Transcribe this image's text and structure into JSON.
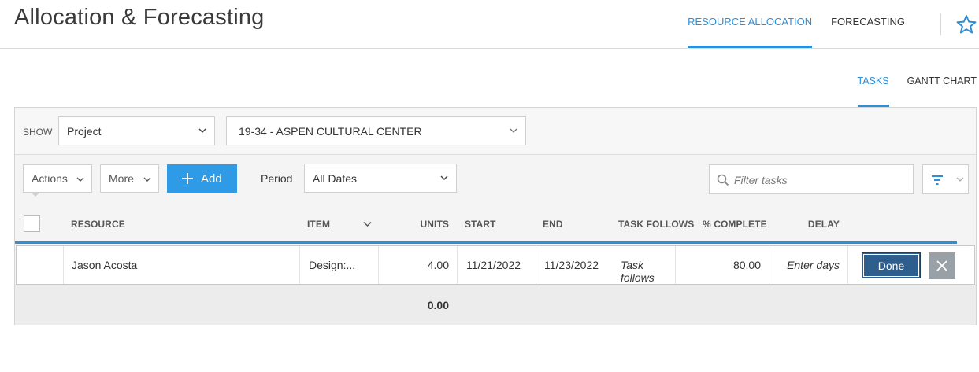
{
  "header": {
    "title": "Allocation & Forecasting",
    "tabs": [
      {
        "label": "RESOURCE ALLOCATION",
        "active": true
      },
      {
        "label": "FORECASTING",
        "active": false
      }
    ],
    "favorite_icon": "star-icon"
  },
  "subtabs": [
    {
      "label": "TASKS",
      "active": true
    },
    {
      "label": "GANTT CHART",
      "active": false
    }
  ],
  "show_bar": {
    "label": "SHOW",
    "type_select": "Project",
    "project_select": "19-34 - ASPEN CULTURAL CENTER"
  },
  "toolbar": {
    "actions_label": "Actions",
    "more_label": "More",
    "add_label": "Add",
    "period_label": "Period",
    "period_value": "All Dates",
    "filter_placeholder": "Filter tasks"
  },
  "columns": [
    "RESOURCE",
    "ITEM",
    "UNITS",
    "START",
    "END",
    "TASK FOLLOWS",
    "% COMPLETE",
    "DELAY"
  ],
  "rows": [
    {
      "resource": "Jason Acosta",
      "item": "Design:...",
      "units": "4.00",
      "start": "11/21/2022",
      "end": "11/23/2022",
      "task_follows": "Task follows",
      "pct_complete": "80.00",
      "delay": "Enter days",
      "done_label": "Done"
    }
  ],
  "totals": {
    "units": "0.00"
  },
  "colors": {
    "accent": "#2f8fd6",
    "add_button": "#2f9be6",
    "done_button": "#2d5e8e"
  }
}
